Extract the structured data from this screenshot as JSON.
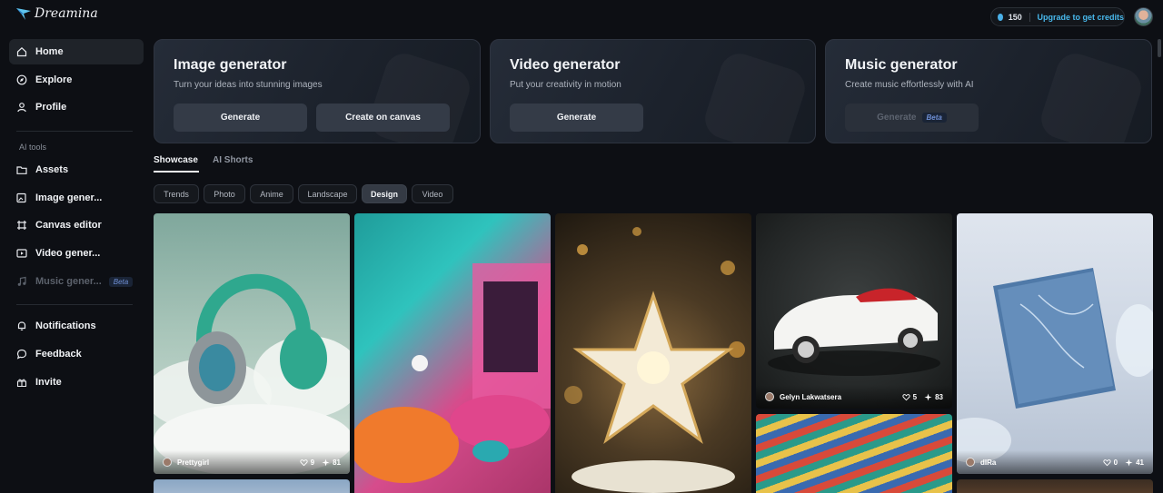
{
  "app": {
    "name": "Dreamina"
  },
  "sidebar": {
    "items": [
      {
        "label": "Home",
        "icon": "home-icon",
        "active": true
      },
      {
        "label": "Explore",
        "icon": "compass-icon"
      },
      {
        "label": "Profile",
        "icon": "user-icon"
      }
    ],
    "section_label": "AI tools",
    "tools": [
      {
        "label": "Assets",
        "icon": "folder-icon"
      },
      {
        "label": "Image gener...",
        "icon": "image-edit-icon"
      },
      {
        "label": "Canvas editor",
        "icon": "canvas-icon"
      },
      {
        "label": "Video gener...",
        "icon": "video-icon"
      },
      {
        "label": "Music gener...",
        "icon": "music-icon",
        "badge": "Beta",
        "disabled": true
      }
    ],
    "footer": [
      {
        "label": "Notifications",
        "icon": "bell-icon"
      },
      {
        "label": "Feedback",
        "icon": "chat-icon"
      },
      {
        "label": "Invite",
        "icon": "invite-icon"
      }
    ]
  },
  "header": {
    "credits": "150",
    "upgrade_label": "Upgrade to get credits"
  },
  "generators": [
    {
      "title": "Image generator",
      "subtitle": "Turn your ideas into stunning images",
      "buttons": [
        "Generate",
        "Create on canvas"
      ]
    },
    {
      "title": "Video generator",
      "subtitle": "Put your creativity in motion",
      "buttons": [
        "Generate"
      ]
    },
    {
      "title": "Music generator",
      "subtitle": "Create music effortlessly with AI",
      "buttons": [
        "Generate"
      ],
      "badge": "Beta"
    }
  ],
  "tabs": [
    "Showcase",
    "AI Shorts"
  ],
  "filters": [
    "Trends",
    "Photo",
    "Anime",
    "Landscape",
    "Design",
    "Video"
  ],
  "active_filter": "Design",
  "gallery": [
    {
      "subject": "headphones in clouds",
      "user": "Prettygirl",
      "likes": "9",
      "remixes": "81"
    },
    {
      "subject": "fluffy neon room",
      "user": "",
      "likes": "",
      "remixes": ""
    },
    {
      "subject": "star ornament",
      "user": "",
      "likes": "",
      "remixes": ""
    },
    {
      "subject": "fluffy white car",
      "user": "Gelyn Lakwatsera",
      "likes": "5",
      "remixes": "83"
    },
    {
      "subject": "frosted blue book",
      "user": "dIRa",
      "likes": "0",
      "remixes": "41"
    },
    {
      "subject": "knitted yarn texture",
      "user": "",
      "likes": "",
      "remixes": ""
    }
  ]
}
